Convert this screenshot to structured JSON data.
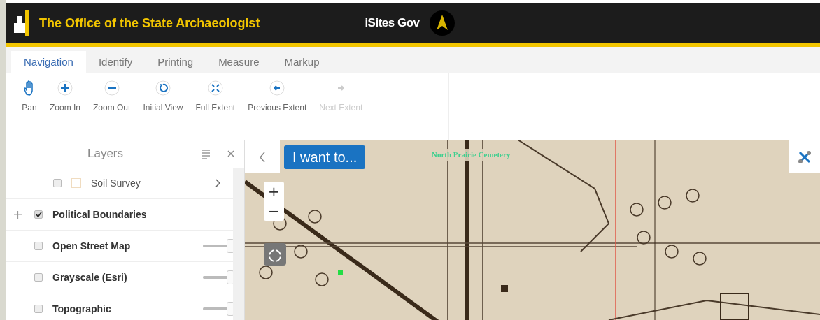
{
  "header": {
    "title": "The Office of the State Archaeologist",
    "brand": "iSites Gov"
  },
  "tabs": [
    {
      "label": "Navigation",
      "selected": true
    },
    {
      "label": "Identify",
      "selected": false
    },
    {
      "label": "Printing",
      "selected": false
    },
    {
      "label": "Measure",
      "selected": false
    },
    {
      "label": "Markup",
      "selected": false
    }
  ],
  "tools": [
    {
      "label": "Pan",
      "disabled": false
    },
    {
      "label": "Zoom In",
      "disabled": false
    },
    {
      "label": "Zoom Out",
      "disabled": false
    },
    {
      "label": "Initial View",
      "disabled": false
    },
    {
      "label": "Full Extent",
      "disabled": false
    },
    {
      "label": "Previous Extent",
      "disabled": false
    },
    {
      "label": "Next Extent",
      "disabled": true
    }
  ],
  "layers_panel": {
    "title": "Layers",
    "layers": [
      {
        "kind": "sublayer",
        "name": "Soil Survey",
        "checked": false
      },
      {
        "kind": "group",
        "name": "Political Boundaries",
        "checked": true
      },
      {
        "kind": "basemap",
        "name": "Open Street Map",
        "checked": false,
        "level": 1
      },
      {
        "kind": "basemap",
        "name": "Grayscale (Esri)",
        "checked": false,
        "level": 1
      },
      {
        "kind": "basemap",
        "name": "Topographic",
        "checked": false,
        "level": 1
      }
    ]
  },
  "map": {
    "menu_button": "I want to...",
    "zoom_in": "+",
    "zoom_out": "−",
    "label": "North Prairie Cemetery"
  }
}
